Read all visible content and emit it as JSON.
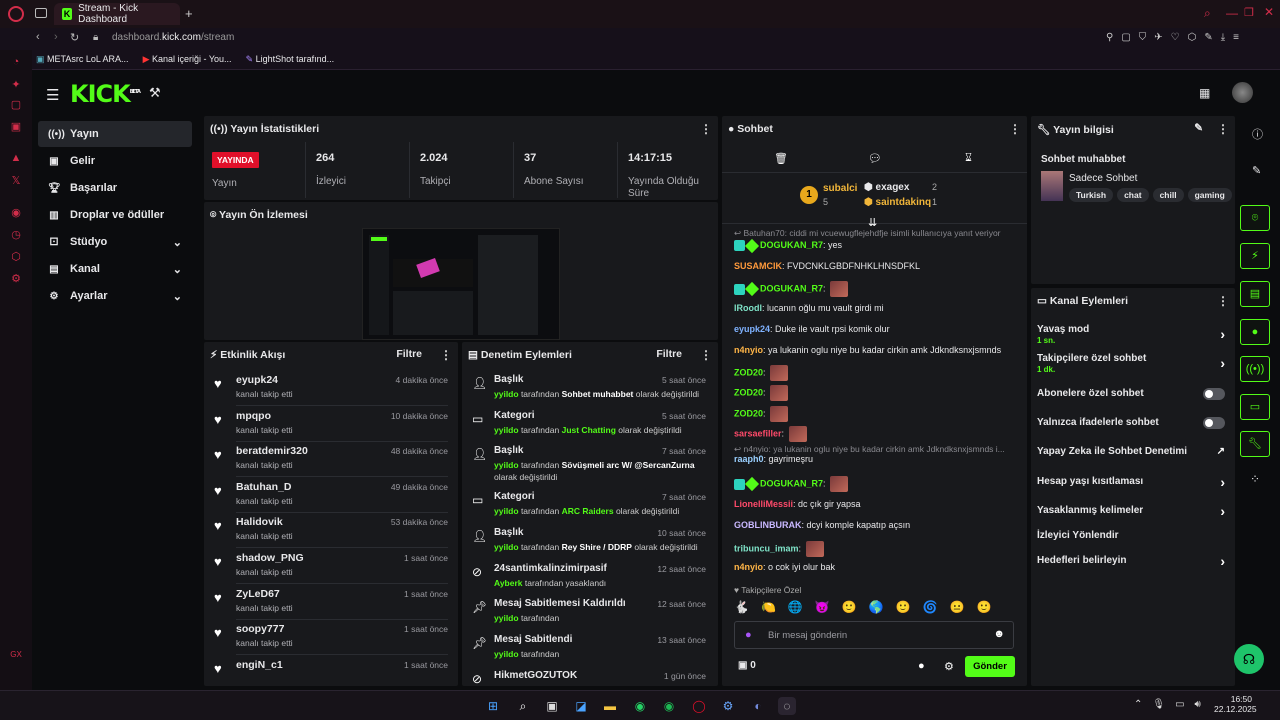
{
  "browser": {
    "tab_title": "Stream - Kick Dashboard",
    "new_tab": "+",
    "url_prefix": "dashboard.",
    "url_host": "kick.com",
    "url_path": "/stream",
    "bookmarks": [
      "METAsrc LoL ARA...",
      "Kanal içeriği - You...",
      "LightShot tarafınd..."
    ]
  },
  "app": {
    "logo": "KICK",
    "logo_badge": "BETA"
  },
  "sidebar": {
    "items": [
      {
        "label": "Yayın",
        "icon": "broadcast-icon"
      },
      {
        "label": "Gelir",
        "icon": "revenue-icon"
      },
      {
        "label": "Başarılar",
        "icon": "trophy-icon"
      },
      {
        "label": "Droplar ve ödüller",
        "icon": "gift-icon"
      },
      {
        "label": "Stüdyo",
        "icon": "studio-icon"
      },
      {
        "label": "Kanal",
        "icon": "channel-icon"
      },
      {
        "label": "Ayarlar",
        "icon": "settings-icon"
      }
    ]
  },
  "stats": {
    "title": "Yayın İstatistikleri",
    "live_badge": "YAYINDA",
    "live_label": "Yayın",
    "viewers": "264",
    "viewers_label": "İzleyici",
    "followers": "2.024",
    "followers_label": "Takipçi",
    "subs": "37",
    "subs_label": "Abone Sayısı",
    "uptime": "14:17:15",
    "uptime_label": "Yayında Olduğu Süre"
  },
  "preview": {
    "title": "Yayın Ön İzlemesi"
  },
  "activity": {
    "title": "Etkinlik Akışı",
    "filter": "Filtre",
    "items": [
      {
        "name": "eyupk24",
        "sub": "kanalı takip etti",
        "time": "4 dakika önce"
      },
      {
        "name": "mpqpo",
        "sub": "kanalı takip etti",
        "time": "10 dakika önce"
      },
      {
        "name": "beratdemir320",
        "sub": "kanalı takip etti",
        "time": "48 dakika önce"
      },
      {
        "name": "Batuhan_D",
        "sub": "kanalı takip etti",
        "time": "49 dakika önce"
      },
      {
        "name": "Halidovik",
        "sub": "kanalı takip etti",
        "time": "53 dakika önce"
      },
      {
        "name": "shadow_PNG",
        "sub": "kanalı takip etti",
        "time": "1 saat önce"
      },
      {
        "name": "ZyLeD67",
        "sub": "kanalı takip etti",
        "time": "1 saat önce"
      },
      {
        "name": "soopy777",
        "sub": "kanalı takip etti",
        "time": "1 saat önce"
      },
      {
        "name": "engiN_c1",
        "sub": "",
        "time": "1 saat önce"
      }
    ]
  },
  "moderation": {
    "title": "Denetim Eylemleri",
    "filter": "Filtre",
    "items": [
      {
        "title": "Başlık",
        "time": "5 saat önce",
        "user": "yyildo",
        "mid": "tarafından",
        "val": "Sohbet muhabbet",
        "end": "olarak değiştirildi"
      },
      {
        "title": "Kategori",
        "time": "5 saat önce",
        "user": "yyildo",
        "mid": "tarafından",
        "val": "Just Chatting",
        "end": "olarak değiştirildi"
      },
      {
        "title": "Başlık",
        "time": "7 saat önce",
        "user": "yyildo",
        "mid": "tarafından",
        "val": "Sövüşmeli arc W/ @SercanZurna",
        "end": "olarak değiştirildi"
      },
      {
        "title": "Kategori",
        "time": "7 saat önce",
        "user": "yyildo",
        "mid": "tarafından",
        "val": "ARC Raiders",
        "end": "olarak değiştirildi"
      },
      {
        "title": "Başlık",
        "time": "10 saat önce",
        "user": "yyildo",
        "mid": "tarafından",
        "val": "Rey Shire / DDRP",
        "end": "olarak değiştirildi"
      },
      {
        "title": "24santimkalinzimirpasif",
        "time": "12 saat önce",
        "user": "Ayberk",
        "mid": "tarafından yasaklandı",
        "val": "",
        "end": ""
      },
      {
        "title": "Mesaj Sabitlemesi Kaldırıldı",
        "time": "12 saat önce",
        "user": "yyildo",
        "mid": "tarafından",
        "val": "",
        "end": ""
      },
      {
        "title": "Mesaj Sabitlendi",
        "time": "13 saat önce",
        "user": "yyildo",
        "mid": "tarafından",
        "val": "",
        "end": ""
      },
      {
        "title": "HikmetGOZUTOK",
        "time": "1 gün önce",
        "user": "",
        "mid": "",
        "val": "",
        "end": ""
      }
    ]
  },
  "chat": {
    "title": "Sohbet",
    "leaders": {
      "first": "subalci",
      "first_count": "5",
      "second": "exagex",
      "second_count": "2",
      "third": "saintdakinq",
      "third_count": "1"
    },
    "reply1": "Batuhan70: ciddi mi vcuewugflejehdfje isimli kullanıcıya yanıt veriyor",
    "reply2": "n4nyio: ya lukanin oglu niye bu kadar cirkin amk Jdkndksnxjsmnds i...",
    "messages": [
      {
        "user": "DOGUKAN_R7",
        "text": "yes",
        "color": "#53fc18"
      },
      {
        "user": "SUSAMCIK",
        "text": "FVDCNKLGBDFNHKLHNSDFKL",
        "color": "#ff9a3c"
      },
      {
        "user": "DOGUKAN_R7",
        "text": "",
        "color": "#53fc18"
      },
      {
        "user": "lRoodl",
        "text": "lucanın oğlu mu vault girdi mi",
        "color": "#7fe3c8"
      },
      {
        "user": "eyupk24",
        "text": "Duke ile vault rpsi komik olur",
        "color": "#7fb2ff"
      },
      {
        "user": "n4nyio",
        "text": "ya lukanin oglu niye bu kadar cirkin amk Jdkndksnxjsmnds",
        "color": "#ffb547"
      },
      {
        "user": "ZOD20",
        "text": "",
        "color": "#53fc18"
      },
      {
        "user": "ZOD20",
        "text": "",
        "color": "#53fc18"
      },
      {
        "user": "ZOD20",
        "text": "",
        "color": "#53fc18"
      },
      {
        "user": "sarsaefiller",
        "text": "",
        "color": "#ff4a6a"
      },
      {
        "user": "raaph0",
        "text": "gayrimeşru",
        "color": "#9ad0ff"
      },
      {
        "user": "DOGUKAN_R7",
        "text": "",
        "color": "#53fc18"
      },
      {
        "user": "LionelliMessii",
        "text": "dc çık gir yapsa",
        "color": "#ff4a6a"
      },
      {
        "user": "GOBLINBURAK",
        "text": "dcyi komple kapatıp açsın",
        "color": "#c9b8ff"
      },
      {
        "user": "tribuncu_imam",
        "text": "",
        "color": "#7fe3c8"
      },
      {
        "user": "n4nyio",
        "text": "o cok iyi olur bak",
        "color": "#ffb547"
      }
    ],
    "followers_only": "Takipçilere Özel",
    "input_placeholder": "Bir mesaj gönderin",
    "points": "0",
    "send": "Gönder"
  },
  "stream_info": {
    "title": "Yayın bilgisi",
    "stream_title": "Sohbet muhabbet",
    "category": "Sadece Sohbet",
    "tags": [
      "Turkish",
      "chat",
      "chill",
      "gaming"
    ]
  },
  "channel_actions": {
    "title": "Kanal Eylemleri",
    "items": [
      {
        "label": "Yavaş mod",
        "sub": "1 sn.",
        "kind": "chevron"
      },
      {
        "label": "Takipçilere özel sohbet",
        "sub": "1 dk.",
        "kind": "chevron"
      },
      {
        "label": "Abonelere özel sohbet",
        "sub": "",
        "kind": "toggle"
      },
      {
        "label": "Yalnızca ifadelerle sohbet",
        "sub": "",
        "kind": "toggle"
      },
      {
        "label": "Yapay Zeka ile Sohbet Denetimi",
        "sub": "",
        "kind": "external"
      },
      {
        "label": "Hesap yaşı kısıtlaması",
        "sub": "",
        "kind": "chevron"
      },
      {
        "label": "Yasaklanmış kelimeler",
        "sub": "",
        "kind": "chevron"
      },
      {
        "label": "İzleyici Yönlendir",
        "sub": "",
        "kind": "none"
      },
      {
        "label": "Hedefleri belirleyin",
        "sub": "",
        "kind": "chevron"
      }
    ]
  },
  "taskbar": {
    "time": "16:50",
    "date": "22.12.2025"
  },
  "colors": {
    "accent": "#53fc18",
    "live": "#e0102a",
    "panel": "#18191c"
  }
}
